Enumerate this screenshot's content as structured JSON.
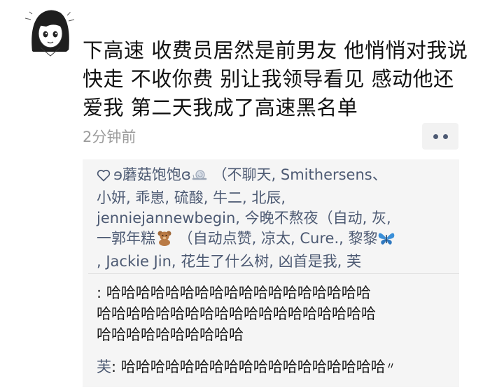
{
  "post": {
    "text_lines": [
      "下高速 收费员居然是前男友 他悄悄对我说",
      "快走 不收你费 别让我领导看见 感动他还",
      "爱我 第二天我成了高速黑名单"
    ],
    "timestamp": "2分钟前"
  },
  "likes": {
    "icon": "heart-outline-icon",
    "lines": [
      [
        "ɘ蘑菇饱饱ɞ",
        " （不聊天, Smithersens、"
      ],
      [
        "小妍, 乖崽, 硫酸, 牛二, 北辰,"
      ],
      [
        "jenniejannewbegin, 今晚不熬夜（自动, 灰,"
      ],
      [
        "一郭年糕",
        " （自动点赞, 凉太, Cure., 黎黎"
      ],
      [
        ", Jackie Jin, 花生了什么树, 凶首是我, 芙"
      ]
    ]
  },
  "comments": [
    {
      "author": "",
      "lines": [
        ": 哈哈哈哈哈哈哈哈哈哈哈哈哈哈哈哈哈哈",
        "哈哈哈哈哈哈哈哈哈哈哈哈哈哈哈哈哈哈哈",
        "哈哈哈哈哈哈哈哈哈哈"
      ]
    },
    {
      "author": "芙",
      "text": ": 哈哈哈哈哈哈哈哈哈哈哈哈哈哈哈哈哈哈"
    }
  ],
  "colors": {
    "name_link": "#4d5a73",
    "timestamp": "#9c9c9c",
    "comment_bg": "#f5f5f5"
  }
}
